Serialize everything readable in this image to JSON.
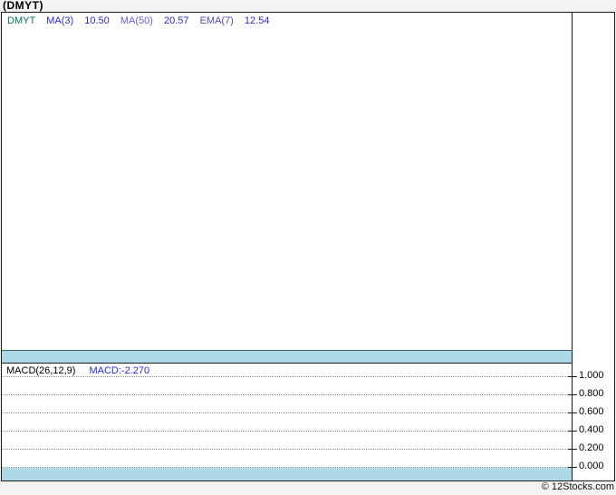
{
  "header": {
    "title": "(DMYT)"
  },
  "main_panel": {
    "legend": {
      "symbol": "DMYT",
      "ma3_label": "MA(3)",
      "ma3_value": "10.50",
      "ma50_label": "MA(50)",
      "ma50_value": "20.57",
      "ema7_label": "EMA(7)",
      "ema7_value": "12.54"
    }
  },
  "macd_panel": {
    "legend_label": "MACD(26,12,9)",
    "legend_value": "MACD:-2.270",
    "ticks": [
      "1.000",
      "0.800",
      "0.600",
      "0.400",
      "0.200",
      "0.000"
    ]
  },
  "footer": {
    "copyright": "© 12Stocks.com"
  },
  "colors": {
    "band_fill": "#ADD8E6",
    "band_stroke": "#44606E",
    "symbol_green": "#007A56",
    "value_blue": "#2A2AD2",
    "ma50_purple": "#5F5FD3",
    "ema7_purple": "#4848B8",
    "border_black": "#1C1C1C",
    "grid_gray": "#8F8F8F"
  },
  "chart_data": [
    {
      "type": "area",
      "title": "(DMYT)",
      "series": [
        {
          "name": "DMYT",
          "values": [],
          "note": "price series renders as a flat filled band along the bottom of the panel; no visible variation"
        }
      ],
      "indicators": [
        {
          "name": "MA(3)",
          "value": 10.5
        },
        {
          "name": "MA(50)",
          "value": 20.57
        },
        {
          "name": "EMA(7)",
          "value": 12.54
        }
      ],
      "xlabel": "",
      "ylabel": "",
      "y_axis_labels": [],
      "grid": false,
      "legend_position": "top-left"
    },
    {
      "type": "line",
      "title": "MACD(26,12,9)",
      "annotations": [
        "MACD:-2.270"
      ],
      "current_value": -2.27,
      "ylim": [
        0.0,
        1.0
      ],
      "yticks": [
        1.0,
        0.8,
        0.6,
        0.4,
        0.2,
        0.0
      ],
      "xlabel": "",
      "ylabel": "",
      "grid": true,
      "grid_style": "dotted horizontal",
      "legend_position": "top-left",
      "note": "MACD series renders as a flat filled band along the bottom of the panel; current value -2.270 lies below the visible axis range"
    }
  ]
}
